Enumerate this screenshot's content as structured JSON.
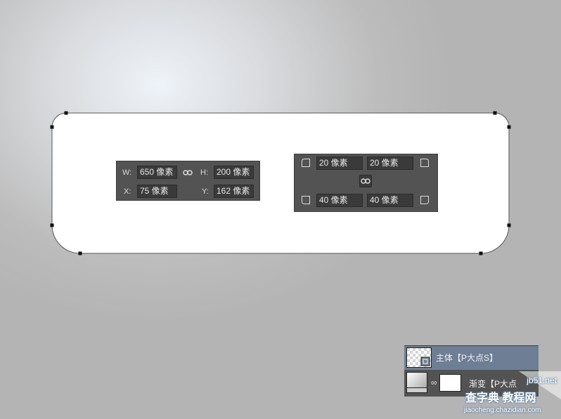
{
  "transform_panel": {
    "w_label": "W:",
    "w_value": "650 像素",
    "h_label": "H:",
    "h_value": "200 像素",
    "x_label": "X:",
    "x_value": "75 像素",
    "y_label": "Y:",
    "y_value": "162 像素"
  },
  "corner_panel": {
    "top_left": "20 像素",
    "top_right": "20 像素",
    "bottom_left": "40 像素",
    "bottom_right": "40 像素"
  },
  "layers": [
    {
      "name": "主体【P大点S】",
      "selected": true
    },
    {
      "name": "渐变【P大点",
      "selected": false
    }
  ],
  "watermark": {
    "site": "jb51.net",
    "chinese": "查字典 教程网",
    "url": "jiaocheng.chazidian.com"
  },
  "colors": {
    "panel_bg": "#535353",
    "field_bg": "#3a3a3a",
    "selected_layer": "#6d7e95",
    "shape_fill": "#ffffff"
  }
}
